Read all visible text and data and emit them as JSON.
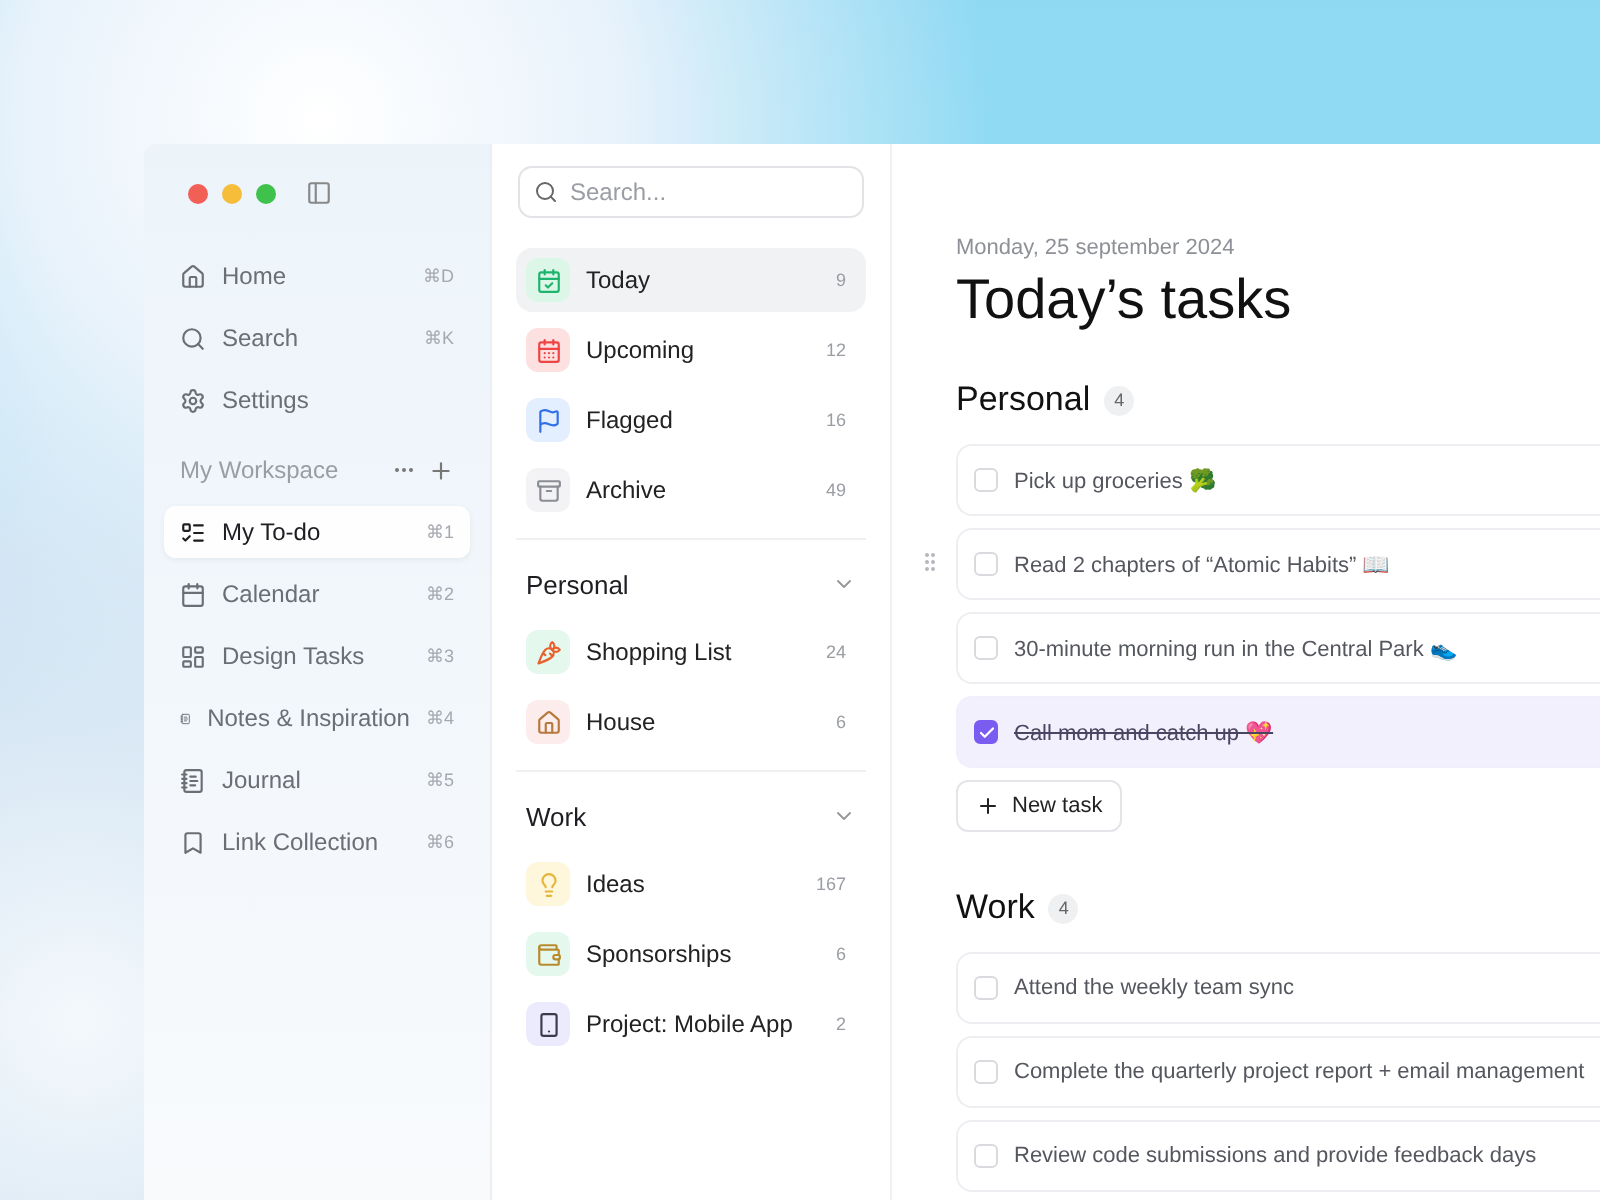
{
  "nav": [
    {
      "label": "Home",
      "shortcut": "⌘D"
    },
    {
      "label": "Search",
      "shortcut": "⌘K"
    },
    {
      "label": "Settings"
    }
  ],
  "workspace": {
    "title": "My Workspace",
    "items": [
      {
        "label": "My To-do",
        "shortcut": "⌘1",
        "selected": true
      },
      {
        "label": "Calendar",
        "shortcut": "⌘2",
        "selected": false
      },
      {
        "label": "Design Tasks",
        "shortcut": "⌘3",
        "selected": false
      },
      {
        "label": "Notes & Inspiration",
        "shortcut": "⌘4",
        "selected": false
      },
      {
        "label": "Journal",
        "shortcut": "⌘5",
        "selected": false
      },
      {
        "label": "Link Collection",
        "shortcut": "⌘6",
        "selected": false
      }
    ]
  },
  "search": {
    "placeholder": "Search..."
  },
  "smart_lists": [
    {
      "label": "Today",
      "count": "9",
      "selected": true
    },
    {
      "label": "Upcoming",
      "count": "12",
      "selected": false
    },
    {
      "label": "Flagged",
      "count": "16",
      "selected": false
    },
    {
      "label": "Archive",
      "count": "49",
      "selected": false
    }
  ],
  "groups": [
    {
      "title": "Personal",
      "expanded": true,
      "lists": [
        {
          "label": "Shopping List",
          "count": "24"
        },
        {
          "label": "House",
          "count": "6"
        }
      ]
    },
    {
      "title": "Work",
      "expanded": true,
      "lists": [
        {
          "label": "Ideas",
          "count": "167"
        },
        {
          "label": "Sponsorships",
          "count": "6"
        },
        {
          "label": "Project: Mobile App",
          "count": "2"
        }
      ]
    }
  ],
  "date": "Monday, 25 september 2024",
  "title": "Today’s tasks",
  "sections": [
    {
      "title": "Personal",
      "count": "4",
      "new_task": "New task",
      "tasks": [
        {
          "text": "Pick up groceries 🥦",
          "checked": false
        },
        {
          "text": "Read 2 chapters of “Atomic Habits” 📖",
          "checked": false
        },
        {
          "text": "30-minute morning run in the Central Park 👟",
          "checked": false
        },
        {
          "text": "Call mom and catch up 💖",
          "checked": true
        }
      ]
    },
    {
      "title": "Work",
      "count": "4",
      "tasks": [
        {
          "text": "Attend the weekly team sync",
          "checked": false
        },
        {
          "text": "Complete the quarterly project report + email management",
          "checked": false
        },
        {
          "text": "Review code submissions and provide feedback days",
          "checked": false
        }
      ]
    }
  ]
}
